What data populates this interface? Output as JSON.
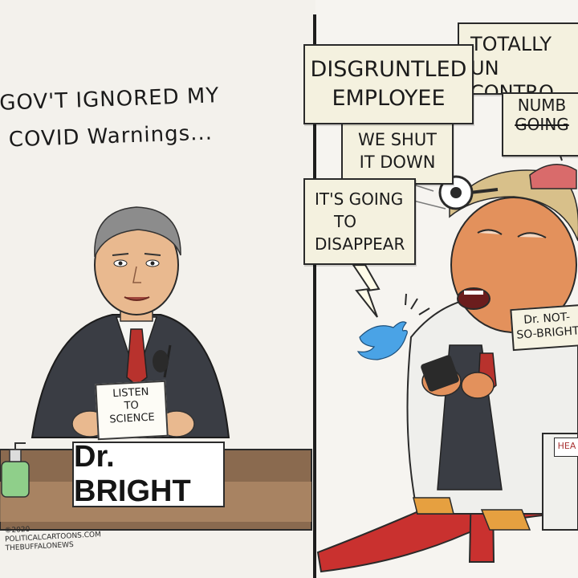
{
  "left_panel": {
    "caption_line1": "GOV'T IGNORED MY",
    "caption_line2": "COVID Warnings...",
    "held_paper_line1": "LISTEN",
    "held_paper_line2": "TO",
    "held_paper_line3": "SCIENCE",
    "desk_sign": "Dr. BRIGHT",
    "credit_line1": "©2020",
    "credit_line2": "POLITICALCARTOONS.COM",
    "credit_line3": "THEBUFFALONEWS"
  },
  "right_panel": {
    "signs": [
      {
        "line1": "DISGRUNTLED",
        "line2": "EMPLOYEE"
      },
      {
        "line1": "TOTALLY UN",
        "line2": "CONTRO"
      },
      {
        "line1": "NUMB",
        "line2": "GOING"
      },
      {
        "line1": "WE SHUT",
        "line2": "IT DOWN"
      },
      {
        "line1": "IT'S GOING",
        "line2": "TO",
        "line3": "DISAPPEAR"
      }
    ],
    "badge_line1": "Dr. NOT-",
    "badge_line2": "SO-BRIGHT",
    "bottle_label": "HEA"
  },
  "colors": {
    "ink": "#1b1b1b",
    "paper": "#f4f1df",
    "suit": "#3a3d44",
    "tie_red": "#b8322d",
    "carpet_red": "#c9312f",
    "twitter_blue": "#4aa3e6",
    "skin": "#e9b98f",
    "trump_skin": "#e3915c",
    "hair": "#d8c08a",
    "sanitizer_green": "#8fcf8a"
  }
}
